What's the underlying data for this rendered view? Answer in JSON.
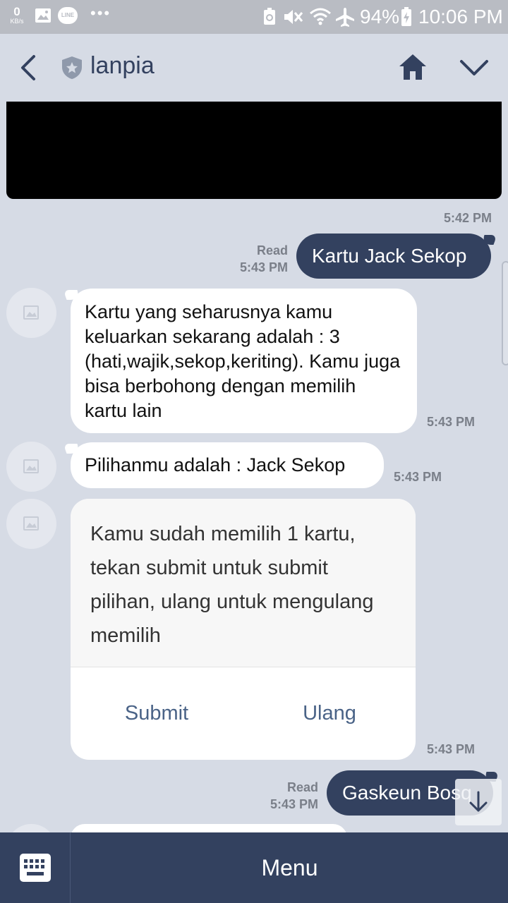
{
  "status_bar": {
    "net_speed_value": "0",
    "net_speed_unit": "KB/s",
    "line_badge": "LINE",
    "more_dots": "•••",
    "battery_percent": "94%",
    "time": "10:06 PM"
  },
  "header": {
    "title": "lanpia"
  },
  "messages": {
    "m0_time": "5:42 PM",
    "m1_text": "Kartu Jack Sekop",
    "m1_read": "Read",
    "m1_time": "5:43 PM",
    "m2_text": "Kartu yang seharusnya kamu keluarkan sekarang adalah : 3 (hati,wajik,sekop,keriting). Kamu juga bisa berbohong dengan memilih kartu lain",
    "m2_time": "5:43 PM",
    "m3_text": "Pilihanmu adalah : Jack Sekop",
    "m3_time": "5:43 PM",
    "m4_text": "Kamu sudah memilih 1 kartu, tekan submit untuk submit pilihan, ulang untuk mengulang memilih",
    "m4_submit": "Submit",
    "m4_ulang": "Ulang",
    "m4_time": "5:43 PM",
    "m5_text": "Gaskeun Bosq",
    "m5_read": "Read",
    "m5_time": "5:43 PM"
  },
  "bottom_bar": {
    "menu_label": "Menu"
  },
  "colors": {
    "accent": "#33415f",
    "chat_bg": "#d6dbe5",
    "link": "#4a6387"
  }
}
